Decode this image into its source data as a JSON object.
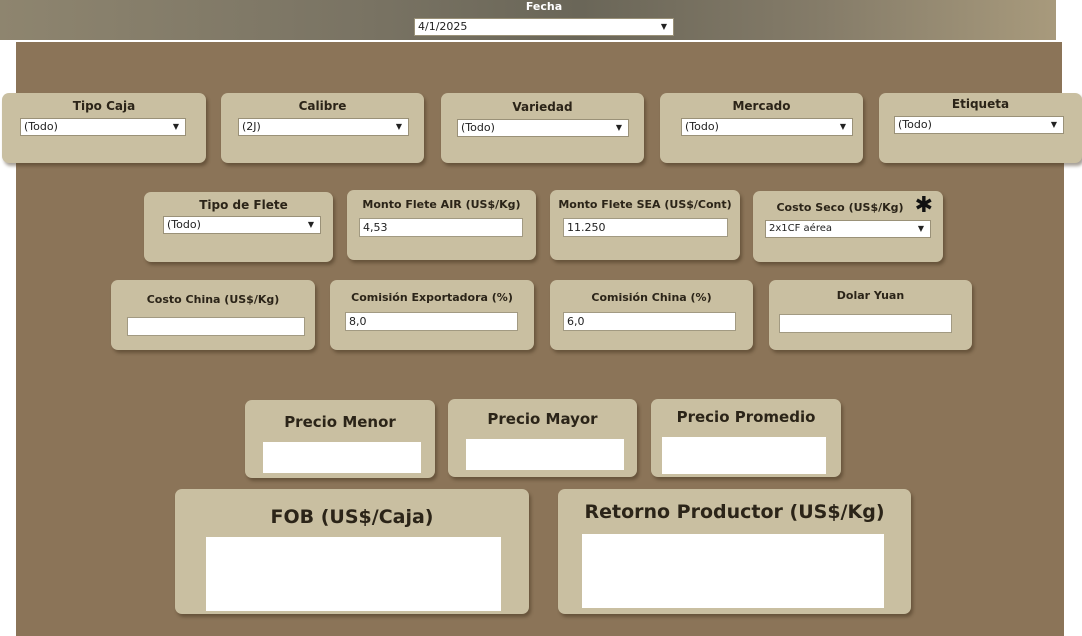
{
  "header": {
    "title": "Fecha",
    "date_value": "4/1/2025"
  },
  "filters_row1": [
    {
      "label": "Tipo Caja",
      "value": "(Todo)"
    },
    {
      "label": "Calibre",
      "value": "(2J)"
    },
    {
      "label": "Variedad",
      "value": "(Todo)"
    },
    {
      "label": "Mercado",
      "value": "(Todo)"
    },
    {
      "label": "Etiqueta",
      "value": "(Todo)"
    }
  ],
  "row2": {
    "tipo_flete": {
      "label": "Tipo de Flete",
      "value": "(Todo)"
    },
    "monto_air": {
      "label": "Monto Flete AIR (US$/Kg)",
      "value": "4,53"
    },
    "monto_sea": {
      "label": "Monto Flete SEA (US$/Cont)",
      "value": "11.250"
    },
    "costo_seco": {
      "label": "Costo Seco (US$/Kg)",
      "value": "2x1CF aérea",
      "marker": "✱"
    }
  },
  "row3": {
    "costo_china": {
      "label": "Costo China (US$/Kg)",
      "value": ""
    },
    "comision_exportadora": {
      "label": "Comisión Exportadora (%)",
      "value": "8,0"
    },
    "comision_china": {
      "label": "Comisión China (%)",
      "value": "6,0"
    },
    "dolar_yuan": {
      "label": "Dolar Yuan",
      "value": ""
    }
  },
  "prices": {
    "menor": "Precio Menor",
    "mayor": "Precio Mayor",
    "promedio": "Precio Promedio"
  },
  "results": {
    "fob": "FOB (US$/Caja)",
    "retorno": "Retorno Productor (US$/Kg)"
  },
  "icons": {
    "caret": "▼"
  }
}
